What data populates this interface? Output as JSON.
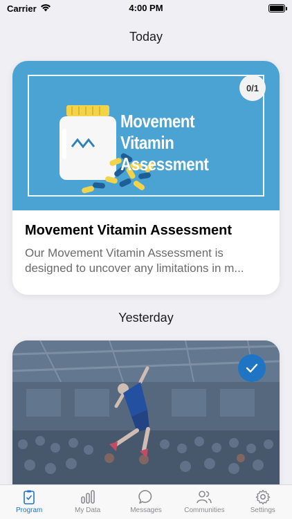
{
  "status_bar": {
    "carrier": "Carrier",
    "time": "4:00 PM"
  },
  "sections": {
    "today": "Today",
    "yesterday": "Yesterday"
  },
  "card_today": {
    "hero_title": "Movement Vitamin Assessment",
    "progress": "0/1",
    "title": "Movement Vitamin Assessment",
    "description": "Our Movement Vitamin Assessment is designed to uncover any limitations in m...",
    "hero_color": "#4aa3d3"
  },
  "card_yesterday": {
    "completed": true,
    "check_color": "#1f74c4"
  },
  "tab_bar": {
    "active_color": "#1f74c4",
    "tabs": [
      {
        "label": "Program",
        "icon": "clipboard-check-icon",
        "active": true
      },
      {
        "label": "My Data",
        "icon": "bar-chart-icon",
        "active": false
      },
      {
        "label": "Messages",
        "icon": "chat-bubble-icon",
        "active": false
      },
      {
        "label": "Communities",
        "icon": "people-icon",
        "active": false
      },
      {
        "label": "Settings",
        "icon": "gear-icon",
        "active": false
      }
    ]
  }
}
